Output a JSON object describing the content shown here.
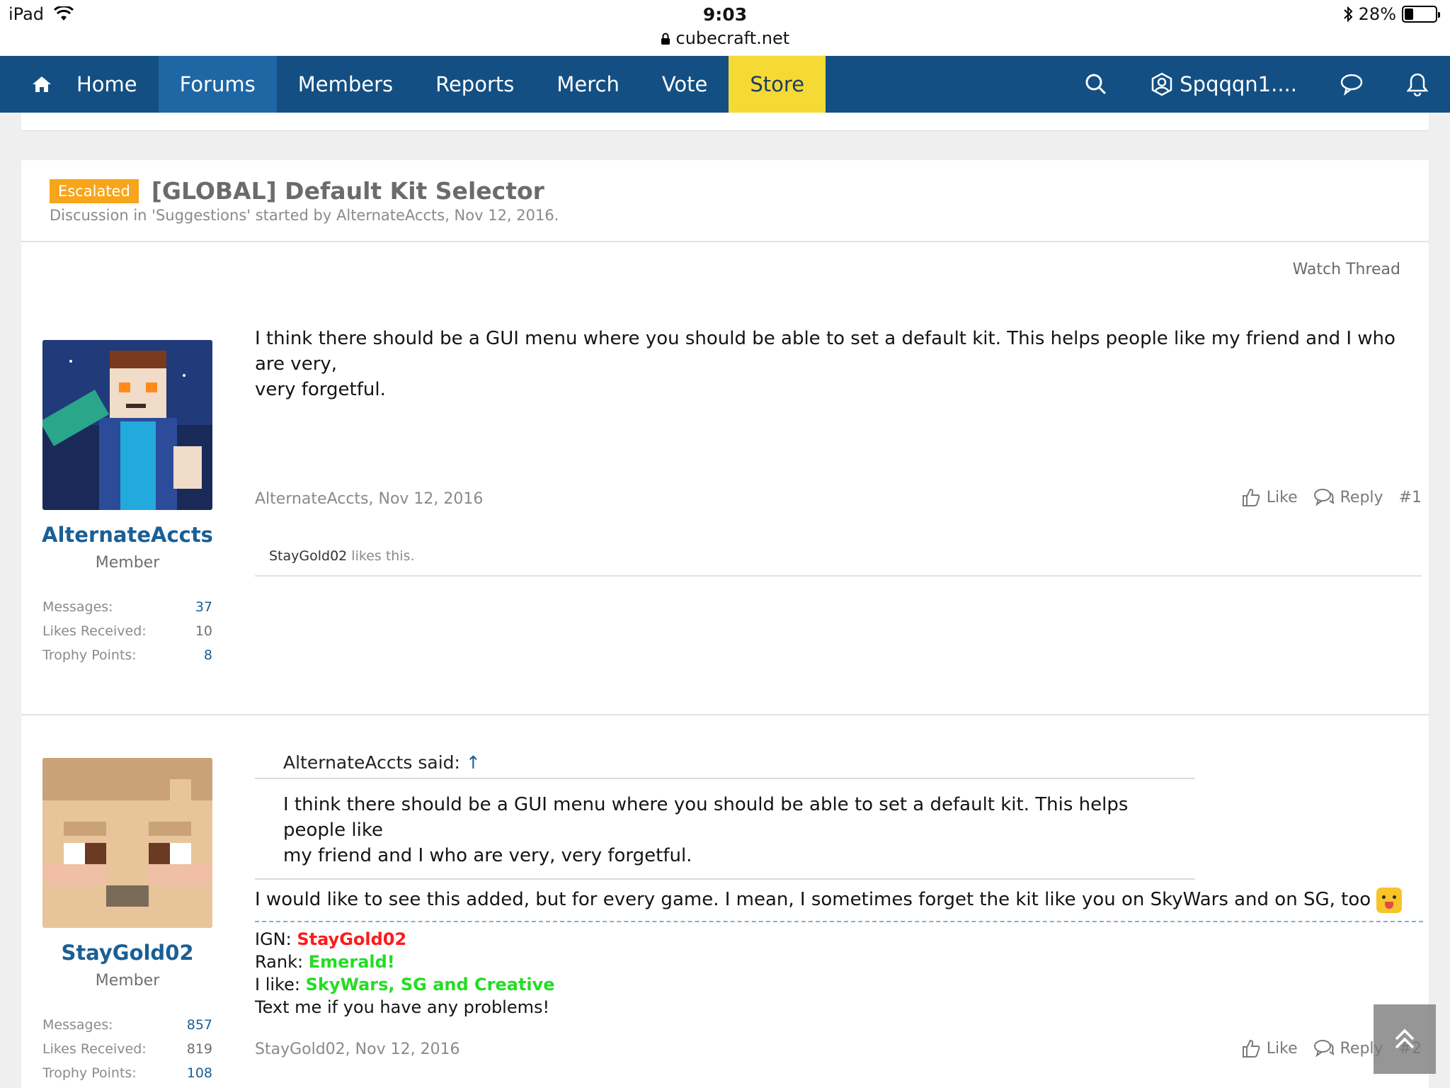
{
  "status_bar": {
    "device": "iPad",
    "time": "9:03",
    "url": "cubecraft.net",
    "battery": "28%",
    "battery_level": 0.28
  },
  "nav": {
    "items": [
      {
        "label": "Home"
      },
      {
        "label": "Forums"
      },
      {
        "label": "Members"
      },
      {
        "label": "Reports"
      },
      {
        "label": "Merch"
      },
      {
        "label": "Vote"
      },
      {
        "label": "Store"
      }
    ],
    "active": "Forums",
    "user": "Spqqqn1....",
    "colors": {
      "bar": "#134f83",
      "active": "#1e66a4",
      "store": "#f5da35"
    }
  },
  "thread": {
    "badge": "Escalated",
    "title": "[GLOBAL] Default Kit Selector",
    "subtitle": "Discussion in 'Suggestions' started by AlternateAccts, Nov 12, 2016.",
    "watch_label": "Watch Thread"
  },
  "posts": [
    {
      "author": "AlternateAccts",
      "role": "Member",
      "stats": {
        "messages_label": "Messages:",
        "messages": "37",
        "likes_label": "Likes Received:",
        "likes": "10",
        "trophy_label": "Trophy Points:",
        "trophy": "8"
      },
      "body_line1": "I think there should be a GUI menu where you should be able to set a default kit. This helps people like my friend and I who are very,",
      "body_line2": "very forgetful.",
      "meta": "AlternateAccts, Nov 12, 2016",
      "like_label": "Like",
      "reply_label": "Reply",
      "number": "#1",
      "likes_user": "StayGold02",
      "likes_text": " likes this."
    },
    {
      "author": "StayGold02",
      "role": "Member",
      "stats": {
        "messages_label": "Messages:",
        "messages": "857",
        "likes_label": "Likes Received:",
        "likes": "819",
        "trophy_label": "Trophy Points:",
        "trophy": "108"
      },
      "quote_author": "AlternateAccts said:",
      "quote_arrow": "↑",
      "quote_line1": "I think there should be a GUI menu where you should be able to set a default kit. This helps people like",
      "quote_line2": "my friend and I who are very, very forgetful.",
      "body": "I would like to see this added, but for every game. I mean, I sometimes forget the kit like you on SkyWars and on SG, too ",
      "signature": {
        "ign_label": "IGN: ",
        "ign": "StayGold02",
        "rank_label": "Rank: ",
        "rank": "Emerald!",
        "like_label": "I like: ",
        "like": "SkyWars, SG and Creative",
        "contact": "Text me if you have any problems!"
      },
      "meta": "StayGold02, Nov 12, 2016",
      "like_label": "Like",
      "reply_label": "Reply",
      "number": "#2"
    }
  ]
}
